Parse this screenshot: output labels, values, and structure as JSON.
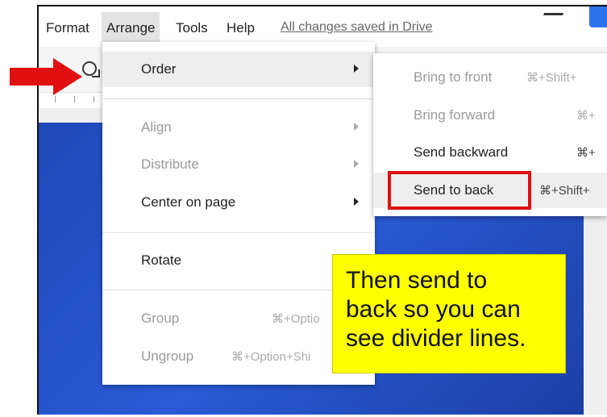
{
  "menubar": {
    "items": [
      "Format",
      "Arrange",
      "Tools",
      "Help"
    ],
    "active_item": "Arrange",
    "saved_status": "All changes saved in Drive"
  },
  "arrange_menu": {
    "items": [
      {
        "label": "Order",
        "has_submenu": true,
        "disabled": false,
        "highlighted": true
      },
      {
        "label": "Align",
        "has_submenu": true,
        "disabled": true
      },
      {
        "label": "Distribute",
        "has_submenu": true,
        "disabled": true
      },
      {
        "label": "Center on page",
        "has_submenu": true,
        "disabled": false
      },
      {
        "label": "Rotate",
        "has_submenu": false,
        "disabled": false
      },
      {
        "label": "Group",
        "shortcut": "⌘+Optio",
        "disabled": true
      },
      {
        "label": "Ungroup",
        "shortcut": "⌘+Option+Shi",
        "disabled": true
      }
    ]
  },
  "order_submenu": {
    "items": [
      {
        "label": "Bring to front",
        "shortcut": "⌘+Shift+",
        "disabled": true
      },
      {
        "label": "Bring forward",
        "shortcut": "⌘+",
        "disabled": true
      },
      {
        "label": "Send backward",
        "shortcut": "⌘+",
        "disabled": false
      },
      {
        "label": "Send to back",
        "shortcut": "⌘+Shift+",
        "disabled": false,
        "highlighted": true
      }
    ]
  },
  "annotation": {
    "callout_text": "Then send to\nback so you can\nsee divider lines.",
    "callout_color": "#ffff00",
    "highlight_box_color": "#e01010",
    "arrow_color": "#e01010"
  },
  "colors": {
    "slide_background": "#2a5ad6",
    "accent_blue": "#2a73e8"
  }
}
